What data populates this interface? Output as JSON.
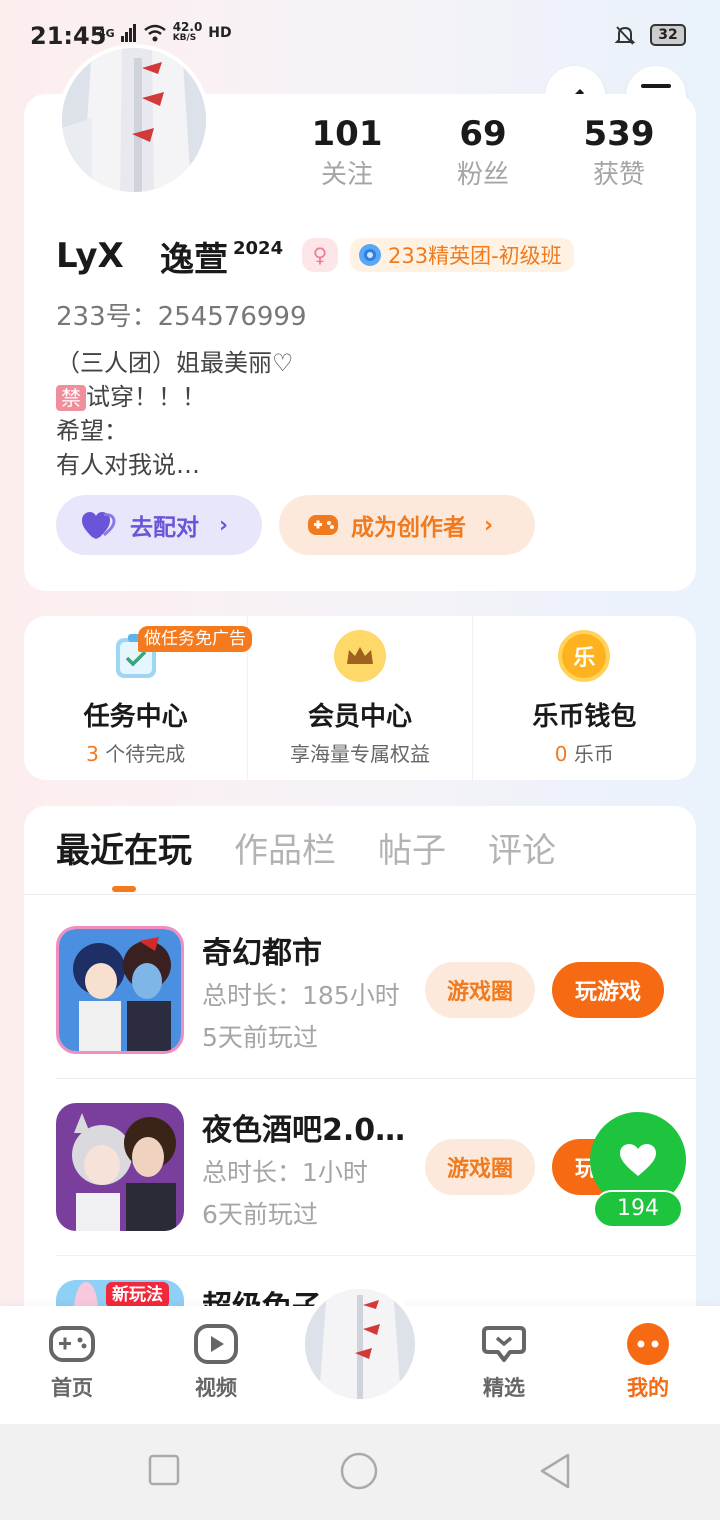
{
  "status_bar": {
    "time": "21:45",
    "network": "4G",
    "speed": "42.0",
    "speed_unit": "KB/S",
    "hd": "HD",
    "battery": "32"
  },
  "profile": {
    "stats": [
      {
        "num": "101",
        "label": "关注"
      },
      {
        "num": "69",
        "label": "粉丝"
      },
      {
        "num": "539",
        "label": "获赞"
      }
    ],
    "username": "LyX",
    "username_suffix": "逸萱",
    "username_year": "2024",
    "gender_symbol": "♀",
    "team_badge": "233精英团-初级班",
    "uid": "233号：254576999",
    "bio_lines": [
      "（三人团）姐最美丽♡",
      "试穿！！！",
      "希望：",
      "有人对我说…"
    ],
    "bio_ban": "禁",
    "match_button": "去配对",
    "creator_button": "成为创作者"
  },
  "quick_entries": {
    "task_tag": "做任务免广告",
    "items": [
      {
        "title": "任务中心",
        "count": "3",
        "sub": " 个待完成",
        "icon": "task-clipboard-icon"
      },
      {
        "title": "会员中心",
        "count": "",
        "sub": "享海量专属权益",
        "icon": "crown-icon"
      },
      {
        "title": "乐币钱包",
        "count": "0",
        "sub": " 乐币",
        "icon": "coin-icon"
      }
    ],
    "coin_glyph": "乐"
  },
  "tabs": [
    "最近在玩",
    "作品栏",
    "帖子",
    "评论"
  ],
  "games": [
    {
      "name": "奇幻都市",
      "duration": "总时长：185小时",
      "last_played": "5天前玩过",
      "circle_btn": "游戏圈",
      "play_btn": "玩游戏"
    },
    {
      "name": "夜色酒吧2.0(…",
      "duration": "总时长：1小时",
      "last_played": "6天前玩过",
      "circle_btn": "游戏圈",
      "play_btn": "玩游戏"
    },
    {
      "name": "超级兔子",
      "tag": "新玩法"
    }
  ],
  "like_count": "194",
  "bottom_nav": [
    {
      "label": "首页",
      "icon": "gamepad-icon"
    },
    {
      "label": "视频",
      "icon": "video-play-icon"
    },
    {
      "label": "精选",
      "icon": "heart-chat-icon"
    },
    {
      "label": "我的",
      "icon": "face-icon"
    }
  ],
  "colors": {
    "accent": "#f56a12",
    "like_green": "#1ec43e",
    "match_purple": "#6a55d9"
  }
}
